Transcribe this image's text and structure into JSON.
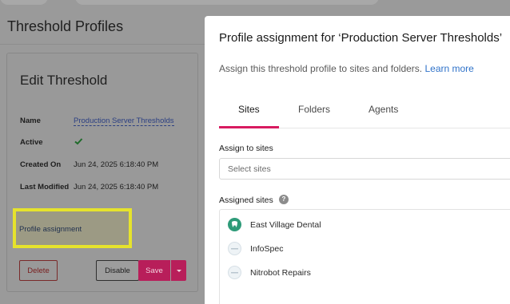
{
  "background": {
    "page_title": "Threshold Profiles",
    "edit_card": {
      "title": "Edit Threshold",
      "fields": {
        "name_label": "Name",
        "name_value": "Production Server Thresholds",
        "active_label": "Active",
        "created_label": "Created On",
        "created_value": "Jun 24, 2025 6:18:40 PM",
        "modified_label": "Last Modified",
        "modified_value": "Jun 24, 2025 6:18:40 PM"
      },
      "profile_assignment_link": "Profile assignment",
      "buttons": {
        "delete": "Delete",
        "disable": "Disable",
        "save": "Save"
      }
    }
  },
  "modal": {
    "title": "Profile assignment for ‘Production Server Thresholds’",
    "description": "Assign this threshold profile to sites and folders.",
    "learn_more": "Learn more",
    "tabs": [
      "Sites",
      "Folders",
      "Agents"
    ],
    "active_tab": "Sites",
    "assign_to_sites_label": "Assign to sites",
    "site_select_placeholder": "Select sites",
    "assigned_sites_label": "Assigned sites",
    "help_glyph": "?",
    "assigned_sites": [
      {
        "name": "East Village Dental",
        "icon": "dental-logo-icon"
      },
      {
        "name": "InfoSpec",
        "icon": "site-logo-icon"
      },
      {
        "name": "Nitrobot Repairs",
        "icon": "site-logo-icon"
      }
    ]
  },
  "colors": {
    "accent": "#d81b60",
    "link": "#2f72c9",
    "highlight": "#e6e32c",
    "overlay": "#9a9a9a"
  }
}
